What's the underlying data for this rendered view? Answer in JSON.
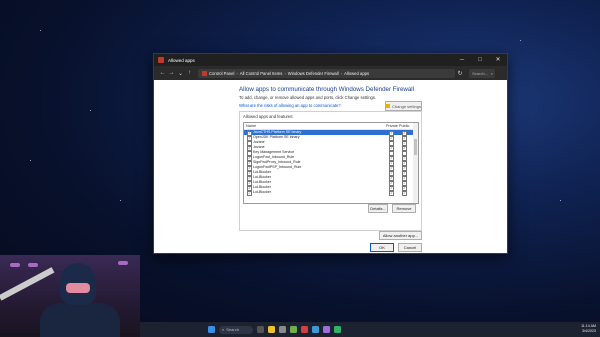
{
  "window": {
    "title": "Allowed apps",
    "controls": {
      "minimize": "─",
      "maximize": "□",
      "close": "✕"
    }
  },
  "nav": {
    "back": "←",
    "forward": "→",
    "down": "⌄",
    "up": "↑",
    "refresh": "↻"
  },
  "breadcrumb": [
    "Control Panel",
    "All Control Panel Items",
    "Windows Defender Firewall",
    "Allowed apps"
  ],
  "search": {
    "placeholder": "Search..."
  },
  "content": {
    "heading": "Allow apps to communicate through Windows Defender Firewall",
    "subtext": "To add, change, or remove allowed apps and ports, click Change settings.",
    "risk_link": "What are the risks of allowing an app to communicate?",
    "change_settings_label": "Change settings",
    "group_label": "Allowed apps and features:",
    "columns": {
      "name": "Name",
      "private": "Private",
      "public": "Public"
    },
    "rows": [
      {
        "name": "JavaCTHS Platform SE binary",
        "checked": true,
        "private": true,
        "public": true,
        "selected": true
      },
      {
        "name": "OpenJDK Platform SE binary",
        "checked": true,
        "private": true,
        "public": true
      },
      {
        "name": "Jovane",
        "checked": false,
        "private": false,
        "public": true
      },
      {
        "name": "Jovane",
        "checked": true,
        "private": true,
        "public": true
      },
      {
        "name": "Key Management Service",
        "checked": false,
        "private": false,
        "public": false
      },
      {
        "name": "LogonFwd_Inbound_Rule",
        "checked": true,
        "private": true,
        "public": true
      },
      {
        "name": "SignFwdProxy_Inbound_Rule",
        "checked": true,
        "private": true,
        "public": true
      },
      {
        "name": "LogonFwdPSP_Inbound_Rule",
        "checked": true,
        "private": true,
        "public": true
      },
      {
        "name": "LoLBlocker",
        "checked": true,
        "private": true,
        "public": true
      },
      {
        "name": "LoLBlocker",
        "checked": true,
        "private": true,
        "public": true
      },
      {
        "name": "LoLBlocker",
        "checked": true,
        "private": true,
        "public": true
      },
      {
        "name": "LoLBlocker",
        "checked": true,
        "private": true,
        "public": true
      },
      {
        "name": "LoLBlocker",
        "checked": true,
        "private": true,
        "public": true
      }
    ],
    "details_label": "Details...",
    "remove_label": "Remove",
    "allow_another_label": "Allow another app...",
    "ok_label": "OK",
    "cancel_label": "Cancel"
  },
  "taskbar": {
    "search_placeholder": "Search",
    "time": "11:14 AM",
    "date": "3/4/2023"
  },
  "colors": {
    "accent": "#2f6fd0",
    "heading": "#1a3e8a",
    "link": "#0b57c9"
  }
}
